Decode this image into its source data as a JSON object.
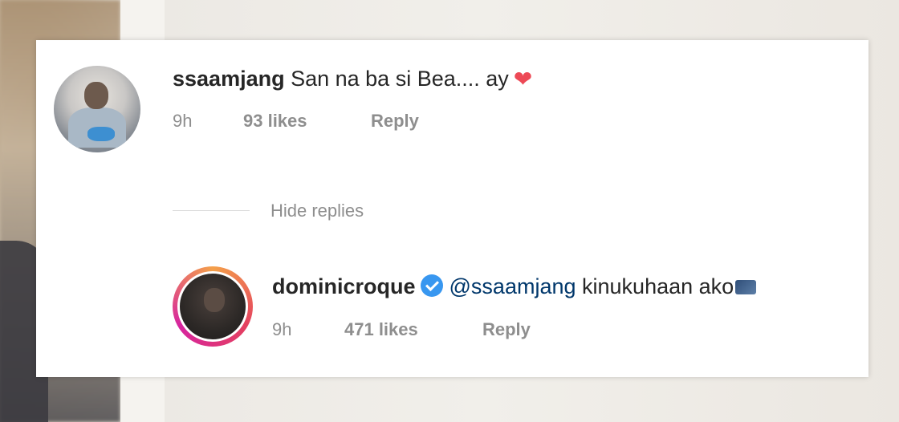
{
  "comment": {
    "username": "ssaamjang",
    "text": "San na ba si Bea.... ay",
    "emoji": "heart-emoji",
    "time": "9h",
    "likes": "93 likes",
    "reply_label": "Reply"
  },
  "hide_replies_label": "Hide replies",
  "reply": {
    "username": "dominicroque",
    "verified": true,
    "mention": "@ssaamjang",
    "text": "kinukuhaan ako",
    "emoji": "camera-emoji",
    "time": "9h",
    "likes": "471 likes",
    "reply_label": "Reply"
  },
  "colors": {
    "heart": "#ed4956",
    "verified": "#3897f0",
    "mention": "#00376b",
    "meta_text": "#8e8e8e"
  }
}
